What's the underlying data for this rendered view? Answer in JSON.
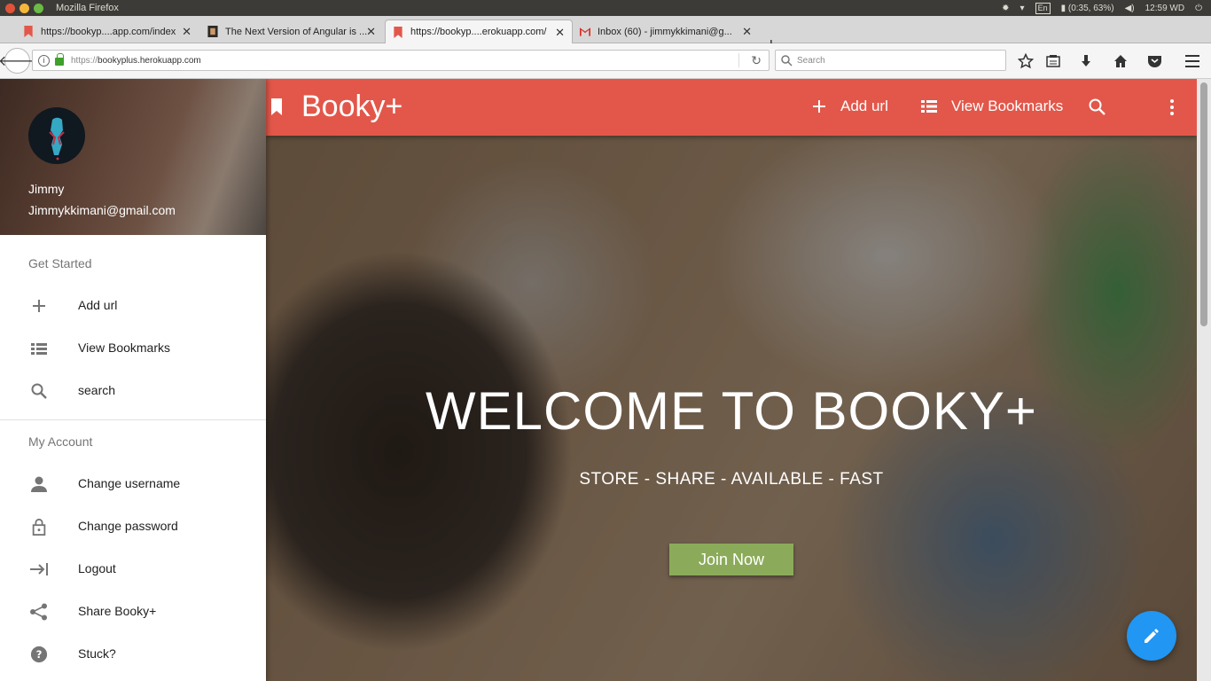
{
  "os": {
    "window_title": "Mozilla Firefox",
    "keyboard": "En",
    "battery": "(0:35, 63%)",
    "clock": "12:59 WD"
  },
  "browser": {
    "tabs": [
      {
        "title": "https://bookyp....app.com/index",
        "active": false
      },
      {
        "title": "The Next Version of Angular is ...",
        "active": false
      },
      {
        "title": "https://bookyp....erokuapp.com/",
        "active": true
      },
      {
        "title": "Inbox (60) - jimmykkimani@g...",
        "active": false
      }
    ],
    "url_scheme": "https://",
    "url_host": "bookyplus.herokuapp.com",
    "search_placeholder": "Search"
  },
  "app": {
    "brand": "Booky+",
    "actions": {
      "add_url": "Add url",
      "view_bookmarks": "View Bookmarks"
    },
    "accent_color": "#e2574a",
    "fab_color": "#2196f3"
  },
  "drawer": {
    "user_name": "Jimmy",
    "user_email": "Jimmykkimani@gmail.com",
    "section_get_started": "Get Started",
    "get_started_items": [
      {
        "label": "Add url",
        "icon": "plus-icon"
      },
      {
        "label": "View Bookmarks",
        "icon": "list-icon"
      },
      {
        "label": "search",
        "icon": "search-icon"
      }
    ],
    "section_account": "My Account",
    "account_items": [
      {
        "label": "Change username",
        "icon": "person-icon"
      },
      {
        "label": "Change password",
        "icon": "lock-icon"
      },
      {
        "label": "Logout",
        "icon": "logout-icon"
      },
      {
        "label": "Share Booky+",
        "icon": "share-icon"
      },
      {
        "label": "Stuck?",
        "icon": "help-icon"
      }
    ]
  },
  "hero": {
    "title": "WELCOME TO BOOKY+",
    "subtitle": "STORE - SHARE - AVAILABLE - FAST",
    "cta": "Join Now",
    "cta_color": "#8bab5a"
  }
}
